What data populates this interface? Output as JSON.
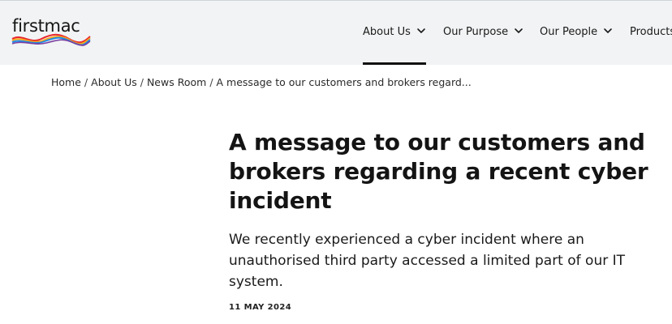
{
  "brand": {
    "logo_text": "firstmac",
    "logo_colors": [
      "#e8262d",
      "#f7a81b",
      "#1e88e5",
      "#7b3fa0"
    ]
  },
  "nav": {
    "items": [
      {
        "label": "About Us",
        "has_dropdown": true,
        "active": true
      },
      {
        "label": "Our Purpose",
        "has_dropdown": true,
        "active": false
      },
      {
        "label": "Our People",
        "has_dropdown": true,
        "active": false
      },
      {
        "label": "Products",
        "has_dropdown": false,
        "active": false
      }
    ]
  },
  "breadcrumb": {
    "items": [
      {
        "label": "Home"
      },
      {
        "label": "About Us"
      },
      {
        "label": "News Room"
      },
      {
        "label": "A message to our customers and brokers regard..."
      }
    ],
    "separator": "/"
  },
  "article": {
    "title": "A message to our customers and brokers regarding a recent cyber incident",
    "lede": "We recently experienced a cyber incident where an unauthorised third party accessed a limited part of our IT system.",
    "date": "11 MAY 2024"
  }
}
